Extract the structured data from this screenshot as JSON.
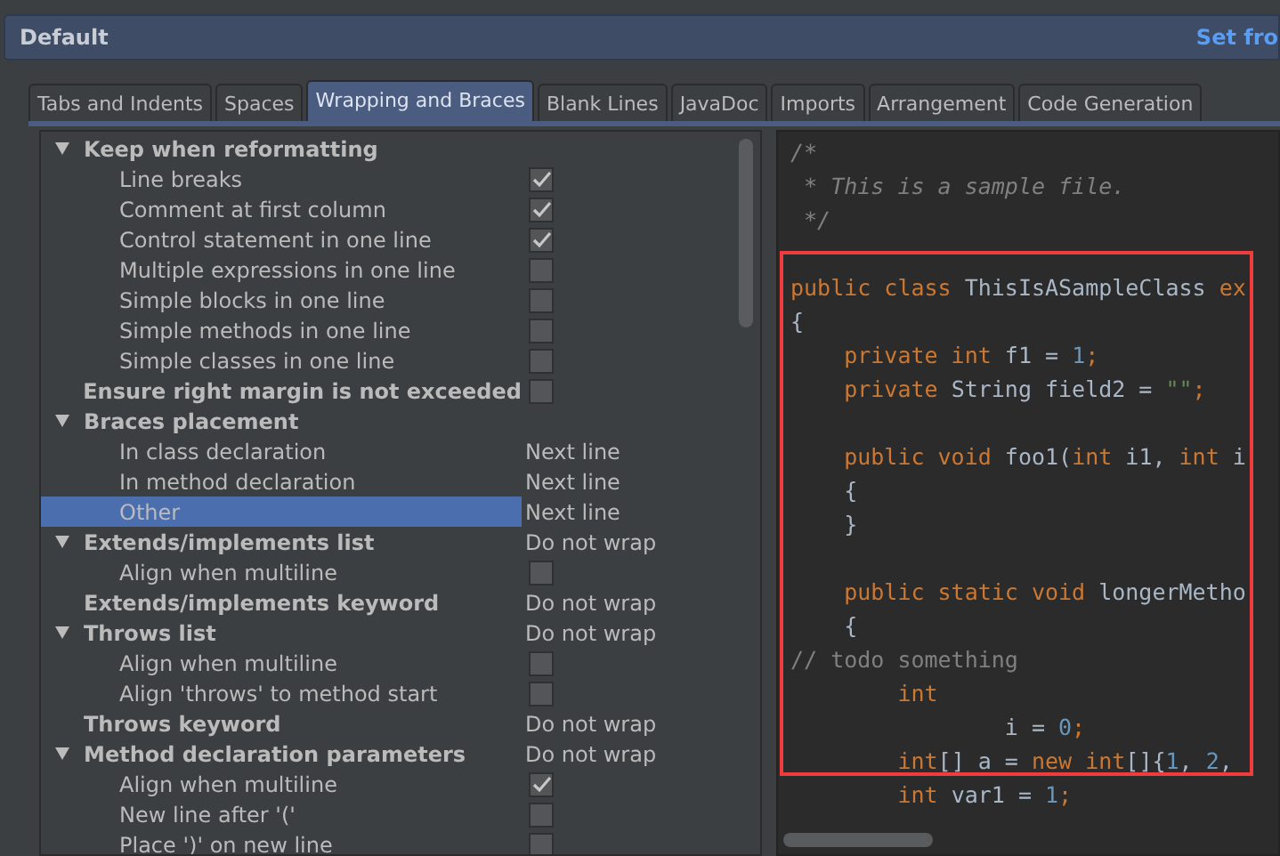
{
  "header": {
    "title": "Default",
    "link": "Set fro"
  },
  "tabs": [
    {
      "label": "Tabs and Indents",
      "selected": false
    },
    {
      "label": "Spaces",
      "selected": false
    },
    {
      "label": "Wrapping and Braces",
      "selected": true
    },
    {
      "label": "Blank Lines",
      "selected": false
    },
    {
      "label": "JavaDoc",
      "selected": false
    },
    {
      "label": "Imports",
      "selected": false
    },
    {
      "label": "Arrangement",
      "selected": false
    },
    {
      "label": "Code Generation",
      "selected": false
    }
  ],
  "settings": [
    {
      "kind": "group",
      "label": "Keep when reformatting",
      "expanded": true,
      "children": [
        {
          "kind": "check",
          "label": "Line breaks",
          "checked": true,
          "selected": false
        },
        {
          "kind": "check",
          "label": "Comment at first column",
          "checked": true,
          "selected": false
        },
        {
          "kind": "check",
          "label": "Control statement in one line",
          "checked": true,
          "selected": false
        },
        {
          "kind": "check",
          "label": "Multiple expressions in one line",
          "checked": false,
          "selected": false
        },
        {
          "kind": "check",
          "label": "Simple blocks in one line",
          "checked": false,
          "selected": false
        },
        {
          "kind": "check",
          "label": "Simple methods in one line",
          "checked": false,
          "selected": false
        },
        {
          "kind": "check",
          "label": "Simple classes in one line",
          "checked": false,
          "selected": false
        }
      ]
    },
    {
      "kind": "check",
      "label": "Ensure right margin is not exceeded",
      "checked": false,
      "selected": false
    },
    {
      "kind": "group",
      "label": "Braces placement",
      "expanded": true,
      "children": [
        {
          "kind": "value",
          "label": "In class declaration",
          "value": "Next line",
          "selected": false
        },
        {
          "kind": "value",
          "label": "In method declaration",
          "value": "Next line",
          "selected": false
        },
        {
          "kind": "value",
          "label": "Other",
          "value": "Next line",
          "selected": true
        }
      ]
    },
    {
      "kind": "group",
      "label": "Extends/implements list",
      "value": "Do not wrap",
      "expanded": true,
      "children": [
        {
          "kind": "check",
          "label": "Align when multiline",
          "checked": false,
          "selected": false
        }
      ]
    },
    {
      "kind": "value",
      "label": "Extends/implements keyword",
      "value": "Do not wrap",
      "selected": false
    },
    {
      "kind": "group",
      "label": "Throws list",
      "value": "Do not wrap",
      "expanded": true,
      "children": [
        {
          "kind": "check",
          "label": "Align when multiline",
          "checked": false,
          "selected": false
        },
        {
          "kind": "check",
          "label": "Align 'throws' to method start",
          "checked": false,
          "selected": false
        }
      ]
    },
    {
      "kind": "value",
      "label": "Throws keyword",
      "value": "Do not wrap",
      "selected": false
    },
    {
      "kind": "group",
      "label": "Method declaration parameters",
      "value": "Do not wrap",
      "expanded": true,
      "children": [
        {
          "kind": "check",
          "label": "Align when multiline",
          "checked": true,
          "selected": false
        },
        {
          "kind": "check",
          "label": "New line after '('",
          "checked": false,
          "selected": false
        },
        {
          "kind": "check",
          "label": "Place ')' on new line",
          "checked": false,
          "selected": false
        }
      ]
    }
  ],
  "code": [
    {
      "kind": "code",
      "tokens": [
        {
          "kind": "comment",
          "text": "/*"
        }
      ]
    },
    {
      "kind": "code",
      "tokens": [
        {
          "kind": "comment",
          "text": " * This is a sample file."
        }
      ]
    },
    {
      "kind": "code",
      "tokens": [
        {
          "kind": "comment",
          "text": " */"
        }
      ]
    },
    {
      "kind": "blank"
    },
    {
      "kind": "code",
      "tokens": [
        {
          "kind": "keyword",
          "text": "public class "
        },
        {
          "kind": "plain",
          "text": "ThisIsASampleClass "
        },
        {
          "kind": "keyword",
          "text": "ex"
        }
      ]
    },
    {
      "kind": "code",
      "tokens": [
        {
          "kind": "plain",
          "text": "{"
        }
      ]
    },
    {
      "kind": "code",
      "tokens": [
        {
          "kind": "keyword",
          "text": "    private int "
        },
        {
          "kind": "plain",
          "text": "f1 = "
        },
        {
          "kind": "number",
          "text": "1"
        },
        {
          "kind": "keyword",
          "text": ";"
        }
      ]
    },
    {
      "kind": "code",
      "tokens": [
        {
          "kind": "keyword",
          "text": "    private "
        },
        {
          "kind": "plain",
          "text": "String field2 = "
        },
        {
          "kind": "string",
          "text": "\"\""
        },
        {
          "kind": "keyword",
          "text": ";"
        }
      ]
    },
    {
      "kind": "blank"
    },
    {
      "kind": "code",
      "tokens": [
        {
          "kind": "keyword",
          "text": "    public void "
        },
        {
          "kind": "plain",
          "text": "foo1("
        },
        {
          "kind": "keyword",
          "text": "int "
        },
        {
          "kind": "plain",
          "text": "i1, "
        },
        {
          "kind": "keyword",
          "text": "int "
        },
        {
          "kind": "plain",
          "text": "i"
        }
      ]
    },
    {
      "kind": "code",
      "tokens": [
        {
          "kind": "plain",
          "text": "    {"
        }
      ]
    },
    {
      "kind": "code",
      "tokens": [
        {
          "kind": "plain",
          "text": "    }"
        }
      ]
    },
    {
      "kind": "blank"
    },
    {
      "kind": "code",
      "tokens": [
        {
          "kind": "keyword",
          "text": "    public static void "
        },
        {
          "kind": "plain",
          "text": "longerMetho"
        }
      ]
    },
    {
      "kind": "code",
      "tokens": [
        {
          "kind": "plain",
          "text": "    {"
        }
      ]
    },
    {
      "kind": "code",
      "tokens": [
        {
          "kind": "linecomment",
          "text": "// todo something"
        }
      ]
    },
    {
      "kind": "code",
      "tokens": [
        {
          "kind": "keyword",
          "text": "        int"
        }
      ]
    },
    {
      "kind": "code",
      "tokens": [
        {
          "kind": "plain",
          "text": "                i = "
        },
        {
          "kind": "number",
          "text": "0"
        },
        {
          "kind": "keyword",
          "text": ";"
        }
      ]
    },
    {
      "kind": "code",
      "tokens": [
        {
          "kind": "keyword",
          "text": "        int"
        },
        {
          "kind": "plain",
          "text": "[] a = "
        },
        {
          "kind": "keyword",
          "text": "new int"
        },
        {
          "kind": "plain",
          "text": "[]{"
        },
        {
          "kind": "number",
          "text": "1"
        },
        {
          "kind": "plain",
          "text": ", "
        },
        {
          "kind": "number",
          "text": "2"
        },
        {
          "kind": "plain",
          "text": ","
        }
      ]
    },
    {
      "kind": "code",
      "tokens": [
        {
          "kind": "keyword",
          "text": "        int "
        },
        {
          "kind": "plain",
          "text": "var1 = "
        },
        {
          "kind": "number",
          "text": "1"
        },
        {
          "kind": "keyword",
          "text": ";"
        }
      ]
    }
  ]
}
